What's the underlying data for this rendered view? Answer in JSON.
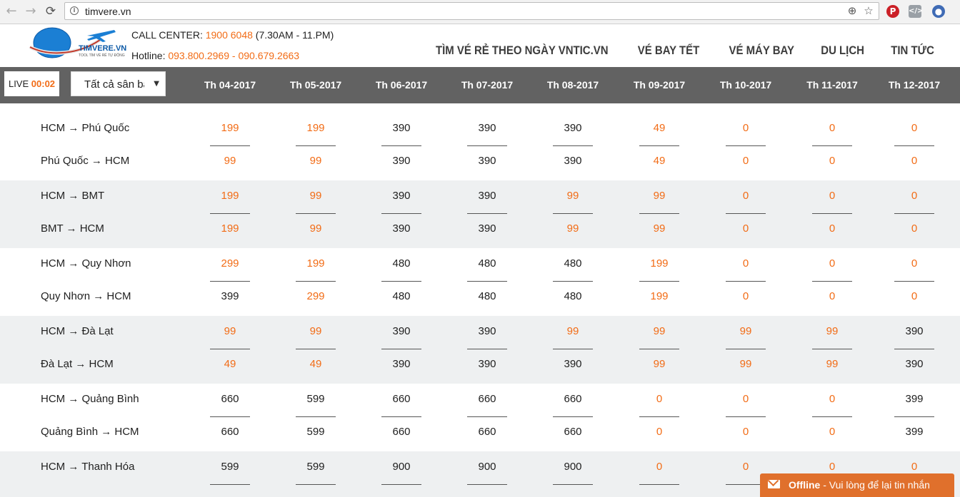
{
  "browser": {
    "url": "timvere.vn",
    "back_icon": "←",
    "forward_icon": "→",
    "reload_icon": "⟳",
    "zoom_icon": "⊕",
    "star_icon": "☆"
  },
  "header": {
    "logo_text": "TIMVERE.VN",
    "logo_tagline": "TOOL TÌM VÉ RẺ TỰ ĐỘNG",
    "call_center_label": "CALL CENTER: ",
    "call_center_number": "1900 6048",
    "call_center_hours": " (7.30AM - 11.PM)",
    "hotline_label": "Hotline: ",
    "hotline_numbers": "093.800.2969 - 090.679.2663",
    "nav": [
      "TÌM VÉ RẺ THEO NGÀY VNTIC.VN",
      "VÉ BAY TẾT",
      "VÉ MÁY BAY",
      "DU LỊCH",
      "TIN TỨC"
    ]
  },
  "toolbar": {
    "live_label": "LIVE",
    "live_time": "00:02",
    "airport_select": "Tất cả sân bay",
    "months": [
      "Th 04-2017",
      "Th 05-2017",
      "Th 06-2017",
      "Th 07-2017",
      "Th 08-2017",
      "Th 09-2017",
      "Th 10-2017",
      "Th 11-2017",
      "Th 12-2017"
    ]
  },
  "routes": [
    {
      "name": "HCM → Phú Quốc",
      "prices": [
        "199",
        "199",
        "390",
        "390",
        "390",
        "49",
        "0",
        "0",
        "0"
      ],
      "low": [
        1,
        1,
        0,
        0,
        0,
        1,
        1,
        1,
        1
      ]
    },
    {
      "name": "Phú Quốc → HCM",
      "prices": [
        "99",
        "99",
        "390",
        "390",
        "390",
        "49",
        "0",
        "0",
        "0"
      ],
      "low": [
        1,
        1,
        0,
        0,
        0,
        1,
        1,
        1,
        1
      ]
    },
    {
      "name": "HCM → BMT",
      "prices": [
        "199",
        "99",
        "390",
        "390",
        "99",
        "99",
        "0",
        "0",
        "0"
      ],
      "low": [
        1,
        1,
        0,
        0,
        1,
        1,
        1,
        1,
        1
      ]
    },
    {
      "name": "BMT → HCM",
      "prices": [
        "199",
        "99",
        "390",
        "390",
        "99",
        "99",
        "0",
        "0",
        "0"
      ],
      "low": [
        1,
        1,
        0,
        0,
        1,
        1,
        1,
        1,
        1
      ]
    },
    {
      "name": "HCM → Quy Nhơn",
      "prices": [
        "299",
        "199",
        "480",
        "480",
        "480",
        "199",
        "0",
        "0",
        "0"
      ],
      "low": [
        1,
        1,
        0,
        0,
        0,
        1,
        1,
        1,
        1
      ]
    },
    {
      "name": "Quy Nhơn → HCM",
      "prices": [
        "399",
        "299",
        "480",
        "480",
        "480",
        "199",
        "0",
        "0",
        "0"
      ],
      "low": [
        0,
        1,
        0,
        0,
        0,
        1,
        1,
        1,
        1
      ]
    },
    {
      "name": "HCM → Đà Lạt",
      "prices": [
        "99",
        "99",
        "390",
        "390",
        "99",
        "99",
        "99",
        "99",
        "390"
      ],
      "low": [
        1,
        1,
        0,
        0,
        1,
        1,
        1,
        1,
        0
      ]
    },
    {
      "name": "Đà Lạt → HCM",
      "prices": [
        "49",
        "49",
        "390",
        "390",
        "390",
        "99",
        "99",
        "99",
        "390"
      ],
      "low": [
        1,
        1,
        0,
        0,
        0,
        1,
        1,
        1,
        0
      ]
    },
    {
      "name": "HCM → Quảng Bình",
      "prices": [
        "660",
        "599",
        "660",
        "660",
        "660",
        "0",
        "0",
        "0",
        "399"
      ],
      "low": [
        0,
        0,
        0,
        0,
        0,
        1,
        1,
        1,
        0
      ]
    },
    {
      "name": "Quảng Bình → HCM",
      "prices": [
        "660",
        "599",
        "660",
        "660",
        "660",
        "0",
        "0",
        "0",
        "399"
      ],
      "low": [
        0,
        0,
        0,
        0,
        0,
        1,
        1,
        1,
        0
      ]
    },
    {
      "name": "HCM → Thanh Hóa",
      "prices": [
        "599",
        "599",
        "900",
        "900",
        "900",
        "0",
        "0",
        "0",
        "0"
      ],
      "low": [
        0,
        0,
        0,
        0,
        0,
        1,
        1,
        1,
        1
      ]
    }
  ],
  "chat": {
    "status": "Offline",
    "message": " - Vui lòng để lại tin nhắn"
  },
  "colors": {
    "accent_orange": "#f26c16",
    "toolbar_bg": "#626262",
    "row_alt_bg": "#eef0f1",
    "chat_bg": "#e0702c"
  }
}
